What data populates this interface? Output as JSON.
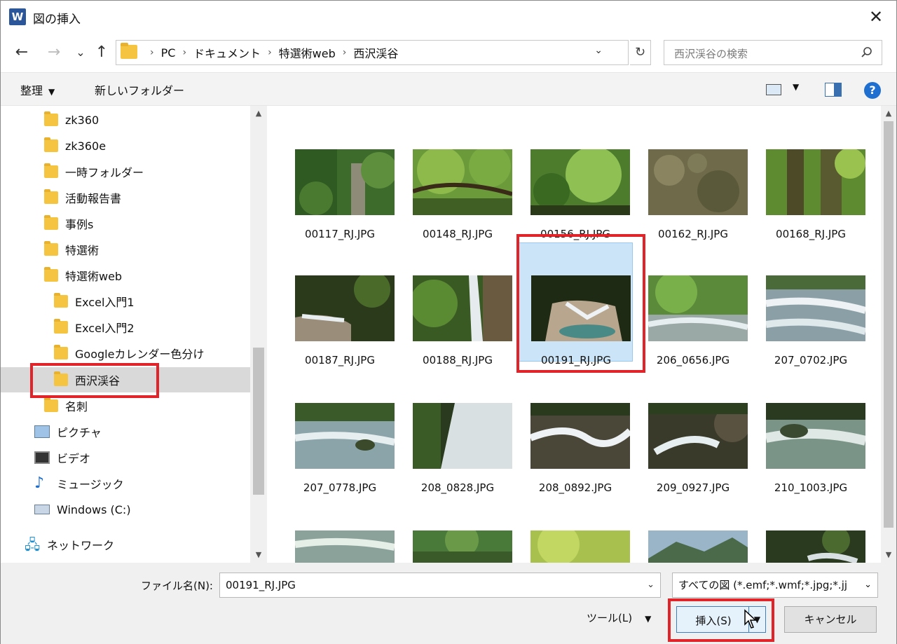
{
  "window": {
    "title": "図の挿入",
    "app_icon": "W",
    "close_glyph": "✕"
  },
  "nav": {
    "back_glyph": "←",
    "forward_glyph": "→",
    "recent_glyph": "⌄",
    "up_glyph": "↑",
    "breadcrumb": [
      "PC",
      "ドキュメント",
      "特選術web",
      "西沢渓谷"
    ],
    "separator": "›",
    "dropdown_glyph": "⌄",
    "refresh_glyph": "↻",
    "search_placeholder": "西沢渓谷の検索"
  },
  "toolbar": {
    "organize_label": "整理",
    "organize_caret": "▼",
    "new_folder_label": "新しいフォルダー",
    "view_caret": "▼",
    "help_glyph": "?"
  },
  "tree": {
    "scroll_up_glyph": "▲",
    "scroll_down_glyph": "▼",
    "items": [
      {
        "label": "zk360",
        "icon": "folder-icon"
      },
      {
        "label": "zk360e",
        "icon": "folder-icon"
      },
      {
        "label": "一時フォルダー",
        "icon": "folder-icon"
      },
      {
        "label": "活動報告書",
        "icon": "folder-icon"
      },
      {
        "label": "事例s",
        "icon": "folder-icon"
      },
      {
        "label": "特選術",
        "icon": "folder-icon"
      },
      {
        "label": "特選術web",
        "icon": "folder-icon"
      },
      {
        "label": "Excel入門1",
        "icon": "folder-icon"
      },
      {
        "label": "Excel入門2",
        "icon": "folder-icon"
      },
      {
        "label": "Googleカレンダー色分け",
        "icon": "folder-icon"
      },
      {
        "label": "西沢渓谷",
        "icon": "folder-icon",
        "selected": true
      },
      {
        "label": "名刺",
        "icon": "folder-icon"
      },
      {
        "label": "ピクチャ",
        "icon": "pictures-icon"
      },
      {
        "label": "ビデオ",
        "icon": "videos-icon"
      },
      {
        "label": "ミュージック",
        "icon": "music-icon"
      },
      {
        "label": "Windows (C:)",
        "icon": "drive-icon"
      },
      {
        "label": "ネットワーク",
        "icon": "network-icon"
      }
    ]
  },
  "files": {
    "scroll_up_glyph": "▲",
    "scroll_down_glyph": "▼",
    "items": [
      "00117_RJ.JPG",
      "00148_RJ.JPG",
      "00156_RJ.JPG",
      "00162_RJ.JPG",
      "00168_RJ.JPG",
      "00187_RJ.JPG",
      "00188_RJ.JPG",
      "00191_RJ.JPG",
      "206_0656.JPG",
      "207_0702.JPG",
      "207_0778.JPG",
      "208_0828.JPG",
      "208_0892.JPG",
      "209_0927.JPG",
      "210_1003.JPG"
    ],
    "selected": "00191_RJ.JPG"
  },
  "footer": {
    "filename_label": "ファイル名(N):",
    "filename_value": "00191_RJ.JPG",
    "dropdown_glyph": "⌄",
    "type_value": "すべての図 (*.emf;*.wmf;*.jpg;*.jj",
    "tools_label": "ツール(L)",
    "tools_caret": "▼",
    "insert_label": "挿入(S)",
    "insert_caret": "▼",
    "cancel_label": "キャンセル"
  },
  "colors": {
    "highlight_red": "#e0242a",
    "selection_blue": "#cce4f7",
    "folder_yellow": "#f5c542"
  }
}
